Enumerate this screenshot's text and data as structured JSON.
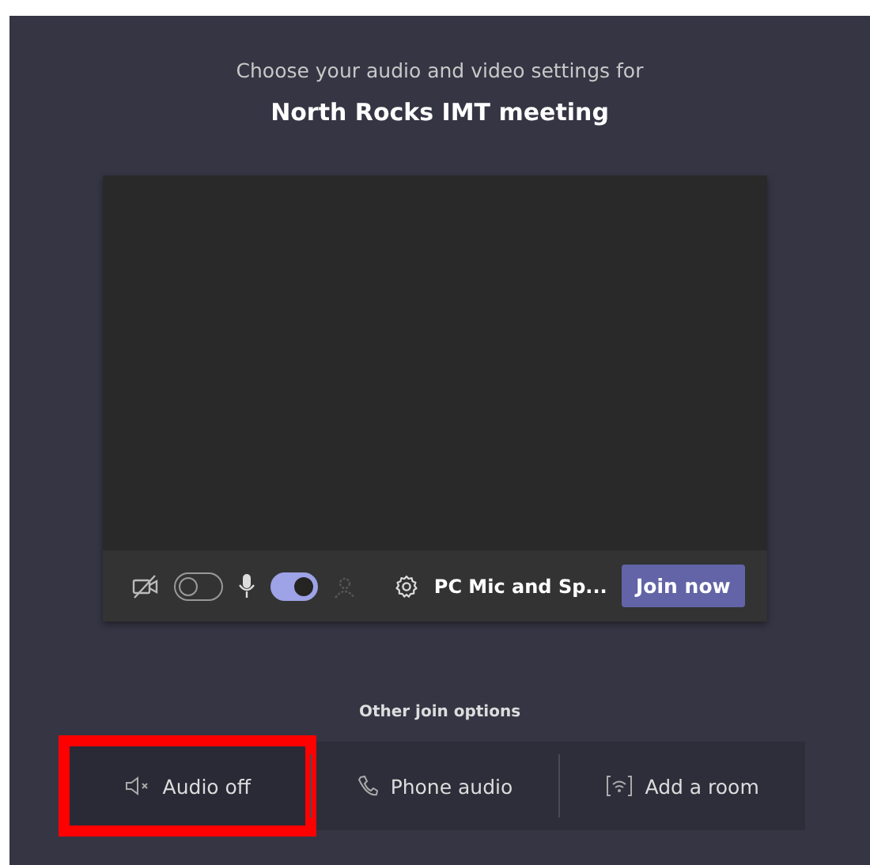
{
  "prompt": "Choose your audio and video settings for",
  "meeting_title": "North Rocks IMT meeting",
  "controls": {
    "camera_on": false,
    "mic_on": true,
    "blur_disabled": true,
    "device": "PC Mic and Sp...",
    "join_button": "Join now"
  },
  "other_options": {
    "heading": "Other join options",
    "items": [
      {
        "kind": "audio-off",
        "label": "Audio off",
        "highlighted": true
      },
      {
        "kind": "phone",
        "label": "Phone audio",
        "highlighted": false
      },
      {
        "kind": "room",
        "label": "Add a room",
        "highlighted": false
      }
    ]
  }
}
